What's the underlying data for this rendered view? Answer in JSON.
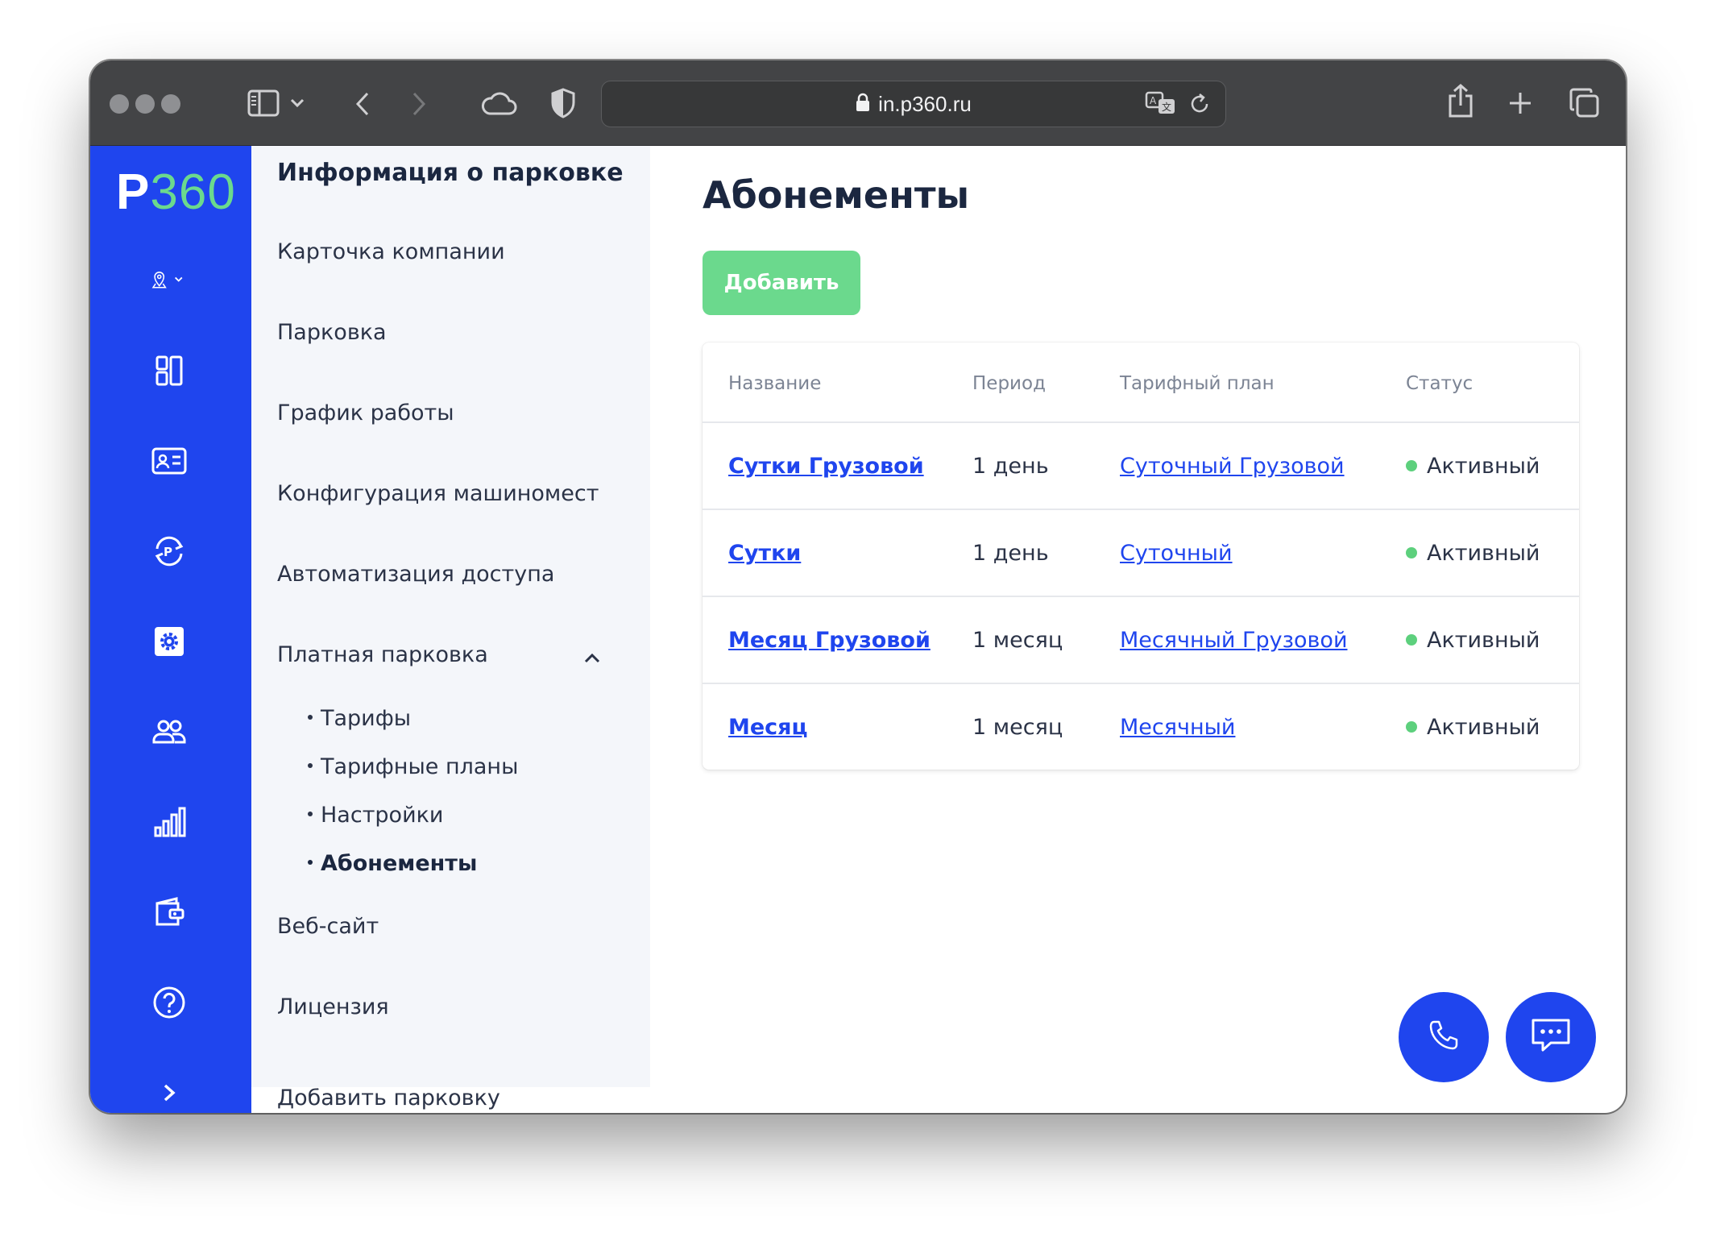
{
  "browser": {
    "url": "in.p360.ru"
  },
  "app": {
    "logo_letter": "P",
    "logo_number": "360",
    "accent_color": "#1f45ee",
    "green_color": "#6bd98d"
  },
  "rail": {
    "icons": [
      "location-pin-icon",
      "dashboard-icon",
      "id-card-icon",
      "parking-sync-icon",
      "settings-gear-icon",
      "users-icon",
      "chart-bars-icon",
      "wallet-icon",
      "help-icon",
      "chevron-right-icon"
    ]
  },
  "submenu": {
    "title": "Информация о парковке",
    "items": [
      "Карточка компании",
      "Парковка",
      "График работы",
      "Конфигурация машиномест",
      "Автоматизация доступа",
      "Платная парковка"
    ],
    "subitems": [
      "Тарифы",
      "Тарифные планы",
      "Настройки",
      "Абонементы"
    ],
    "bottom_items": [
      "Веб-сайт",
      "Лицензия",
      "Добавить парковку"
    ]
  },
  "main": {
    "title": "Абонементы",
    "add_label": "Добавить",
    "table": {
      "headers": [
        "Название",
        "Период",
        "Тарифный план",
        "Статус"
      ],
      "rows": [
        {
          "name": "Сутки Грузовой",
          "period": "1 день",
          "plan": "Суточный Грузовой",
          "status": "Активный"
        },
        {
          "name": "Сутки",
          "period": "1 день",
          "plan": "Суточный",
          "status": "Активный"
        },
        {
          "name": "Месяц Грузовой",
          "period": "1 месяц",
          "plan": "Месячный Грузовой",
          "status": "Активный"
        },
        {
          "name": "Месяц",
          "period": "1 месяц",
          "plan": "Месячный",
          "status": "Активный"
        }
      ]
    }
  },
  "fabs": [
    "phone-icon",
    "chat-icon"
  ]
}
